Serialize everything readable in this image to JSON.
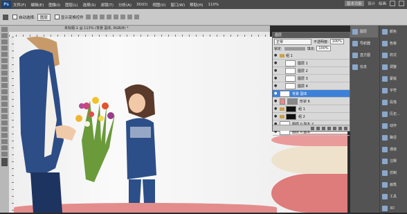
{
  "menubar": {
    "logo": "Ps",
    "items": [
      "文件(F)",
      "编辑(E)",
      "图像(I)",
      "图层(L)",
      "选择(S)",
      "滤镜(T)",
      "分析(A)",
      "3D(D)",
      "视图(V)",
      "窗口(W)",
      "帮助(H)"
    ],
    "zoom": "110%",
    "workspaces": [
      "基本功能",
      "设计",
      "绘画"
    ]
  },
  "options": {
    "auto_select_label": "自动选择:",
    "auto_select_value": "图层",
    "show_transform_label": "显示变换控件"
  },
  "document": {
    "tab_title": "未标题-1 @ 113% (背景 副本, RGB/8) *"
  },
  "layers": {
    "panel_title": "图层",
    "blend_mode": "正常",
    "opacity_label": "不透明度:",
    "opacity_value": "100%",
    "lock_label": "锁定:",
    "fill_label": "填充:",
    "fill_value": "100%",
    "items": [
      {
        "name": "组 1",
        "type": "group",
        "selected": false
      },
      {
        "name": "图层 1",
        "type": "layer",
        "selected": false
      },
      {
        "name": "图层 2",
        "type": "layer",
        "selected": false
      },
      {
        "name": "图层 3",
        "type": "layer",
        "selected": false
      },
      {
        "name": "图层 4",
        "type": "layer",
        "selected": false
      },
      {
        "name": "背景 副本",
        "type": "layer",
        "selected": true
      },
      {
        "name": "形状 6",
        "type": "layer",
        "selected": false
      },
      {
        "name": "组 1",
        "type": "group",
        "selected": false
      },
      {
        "name": "组 2",
        "type": "group",
        "selected": false
      },
      {
        "name": "图层 0 副本 2",
        "type": "layer",
        "selected": false
      },
      {
        "name": "图层 0 副本",
        "type": "layer",
        "selected": false
      }
    ]
  },
  "dock_left": [
    "图层",
    "导航器",
    "直方图",
    "信息"
  ],
  "dock_right": [
    "颜色",
    "色板",
    "样式",
    "调整",
    "蒙版",
    "字符",
    "段落",
    "历史...",
    "动作",
    "路径",
    "通道",
    "注释",
    "仿制",
    "画笔",
    "工具",
    "3D"
  ]
}
